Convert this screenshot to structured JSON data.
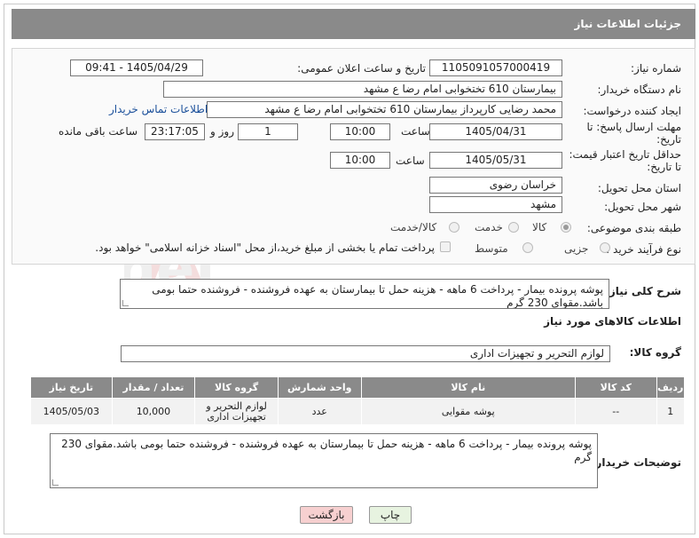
{
  "header": {
    "title": "جزئیات اطلاعات نیاز"
  },
  "form": {
    "need_number": {
      "label": "شماره نیاز:",
      "value": "1105091057000419"
    },
    "announce": {
      "label": "تاریخ و ساعت اعلان عمومی:",
      "value": "1405/04/29 - 09:41"
    },
    "buyer_org": {
      "label": "نام دستگاه خریدار:",
      "value": "بیمارستان 610 تختخوابی امام رضا ع  مشهد"
    },
    "requester": {
      "label": "ایجاد کننده درخواست:",
      "value": "محمد رضایی کارپرداز بیمارستان 610 تختخوابی امام رضا ع  مشهد",
      "contact_link": "اطلاعات تماس خریدار"
    },
    "reply_deadline": {
      "label_line1": "مهلت ارسال پاسخ: تا",
      "label_line2": "تاریخ:",
      "date": "1405/04/31",
      "time_label": "ساعت",
      "time": "10:00",
      "days": "1",
      "days_label": "روز و",
      "remaining": "23:17:05",
      "remaining_label": "ساعت باقی مانده"
    },
    "price_validity": {
      "label_line1": "حداقل تاریخ اعتبار قیمت:",
      "label_line2": "تا تاریخ:",
      "date": "1405/05/31",
      "time_label": "ساعت",
      "time": "10:00"
    },
    "province": {
      "label": "استان محل تحویل:",
      "value": "خراسان رضوی"
    },
    "city": {
      "label": "شهر محل تحویل:",
      "value": "مشهد"
    },
    "category": {
      "label": "طبقه بندی موضوعی:",
      "options": [
        "کالا",
        "خدمت",
        "کالا/خدمت"
      ],
      "selected": "کالا"
    },
    "purchase_type": {
      "label": "نوع فرآیند خرید :",
      "options": [
        "جزیی",
        "متوسط"
      ],
      "payment_note": "پرداخت تمام یا بخشی از مبلغ خرید،از محل \"اسناد خزانه اسلامی\" خواهد بود."
    }
  },
  "summary": {
    "label": "شرح کلی نیاز:",
    "text": "پوشه پرونده بیمار - پرداخت 6 ماهه - هزینه حمل تا بیمارستان به عهده فروشنده - فروشنده حتما بومی باشد.مقوای 230 گرم"
  },
  "goods_info": {
    "title": "اطلاعات کالاهای مورد نیاز",
    "group_label": "گروه کالا:",
    "group_value": "لوازم التحریر و تجهیزات اداری"
  },
  "table": {
    "headers": [
      "ردیف",
      "کد کالا",
      "نام کالا",
      "واحد شمارش",
      "گروه کالا",
      "تعداد / مقدار",
      "تاریخ نیاز"
    ],
    "rows": [
      [
        "1",
        "--",
        "پوشه مقوایی",
        "عدد",
        "لوازم التحریر و تجهیزات اداری",
        "10,000",
        "1405/05/03"
      ]
    ]
  },
  "buyer_notes": {
    "label": "توضیحات خریدار:",
    "text": "پوشه پرونده بیمار - پرداخت 6 ماهه - هزینه حمل تا بیمارستان به عهده فروشنده - فروشنده حتما بومی باشد.مقوای 230 گرم"
  },
  "buttons": {
    "print": "چاپ",
    "back": "بازگشت"
  },
  "watermark": {
    "text": "AriaTender.net"
  },
  "colors": {
    "header_bg": "#8a8a8a",
    "link": "#1a4f9a",
    "back_btn": "#f7d0d0",
    "print_btn": "#e7f3e0"
  }
}
